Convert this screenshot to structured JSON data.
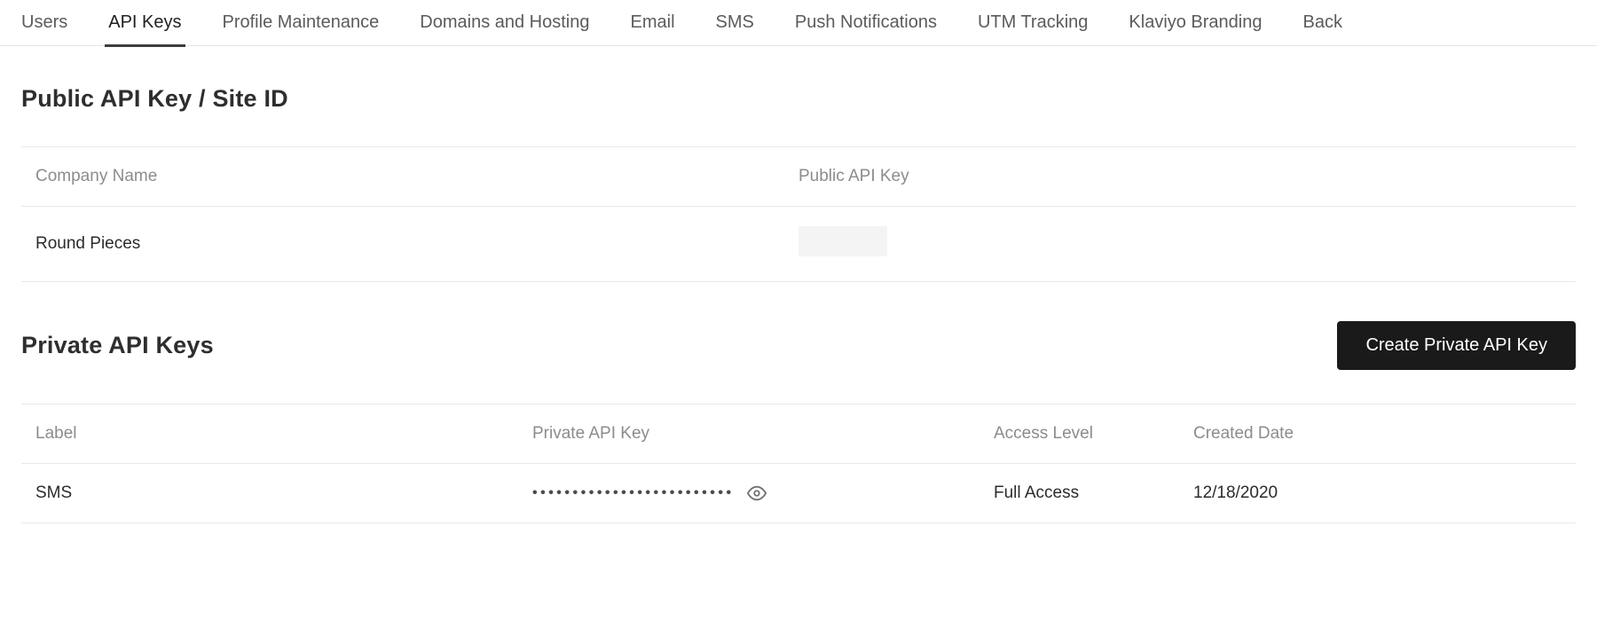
{
  "tabs": {
    "items": [
      {
        "label": "Users",
        "active": false
      },
      {
        "label": "API Keys",
        "active": true
      },
      {
        "label": "Profile Maintenance",
        "active": false
      },
      {
        "label": "Domains and Hosting",
        "active": false
      },
      {
        "label": "Email",
        "active": false
      },
      {
        "label": "SMS",
        "active": false
      },
      {
        "label": "Push Notifications",
        "active": false
      },
      {
        "label": "UTM Tracking",
        "active": false
      },
      {
        "label": "Klaviyo Branding",
        "active": false
      },
      {
        "label": "Back",
        "active": false
      }
    ]
  },
  "public_section": {
    "title": "Public API Key / Site ID",
    "columns": {
      "company": "Company Name",
      "public_key": "Public API Key"
    },
    "row": {
      "company": "Round Pieces",
      "public_key_redacted": true
    }
  },
  "private_section": {
    "title": "Private API Keys",
    "create_button": "Create Private API Key",
    "columns": {
      "label": "Label",
      "private_key": "Private API Key",
      "access_level": "Access Level",
      "created_date": "Created Date"
    },
    "rows": [
      {
        "label": "SMS",
        "masked_key": "•••••••••••••••••••••••••",
        "access_level": "Full Access",
        "created_date": "12/18/2020"
      }
    ]
  }
}
